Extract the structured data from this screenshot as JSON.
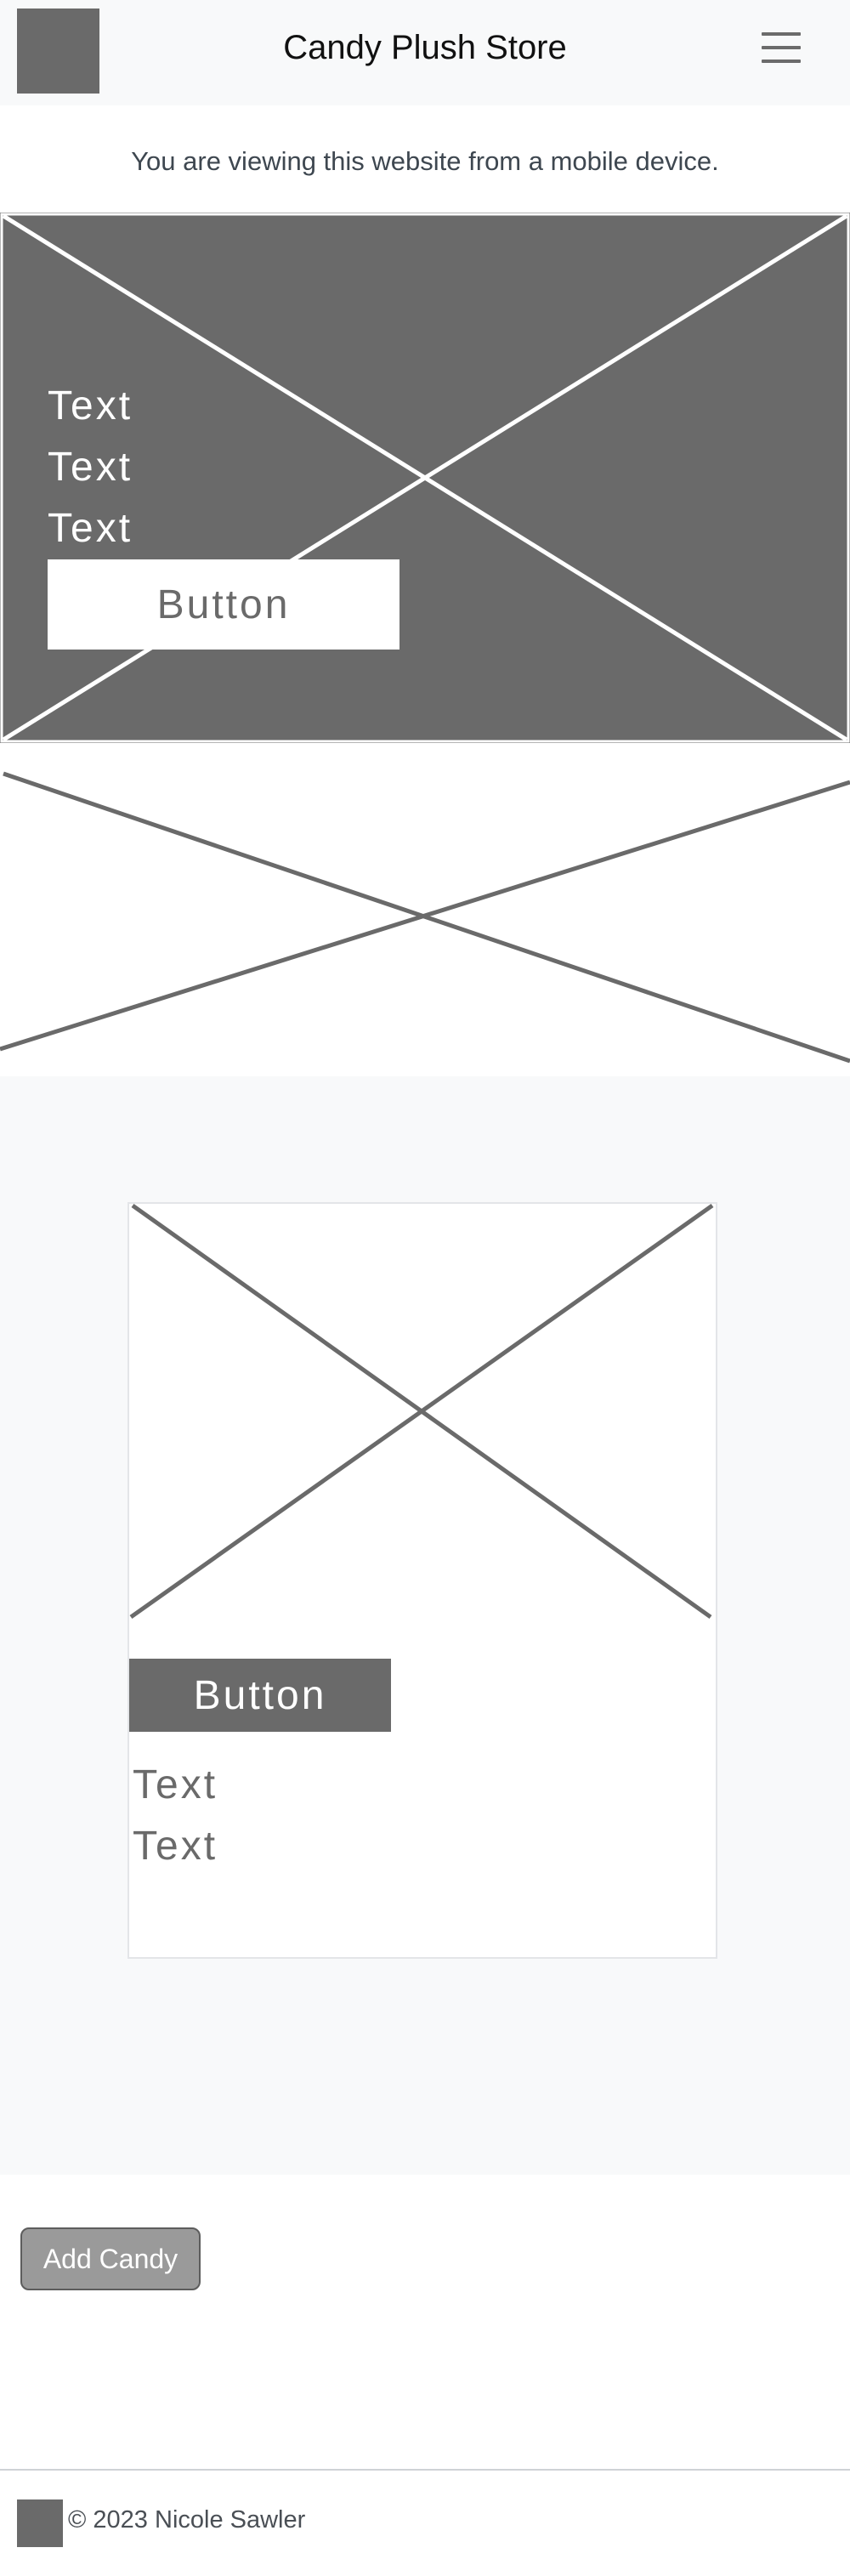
{
  "navbar": {
    "brand": "Candy Plush Store",
    "logo_icon": "image-placeholder-icon",
    "menu_icon": "hamburger-menu-icon"
  },
  "notice": {
    "text": "You are viewing this website from a mobile device."
  },
  "hero": {
    "texts": [
      "Text",
      "Text",
      "Text"
    ],
    "button_label": "Button",
    "background_color": "#6a6a6a"
  },
  "card": {
    "button_label": "Button",
    "texts": [
      "Text",
      "Text"
    ]
  },
  "actions": {
    "add_label": "Add Candy"
  },
  "footer": {
    "copyright": "© 2023 Nicole Sawler"
  },
  "colors": {
    "placeholder_gray": "#6a6a6a",
    "section_background": "#f8f9fa",
    "add_button": "#9a9a9a"
  }
}
